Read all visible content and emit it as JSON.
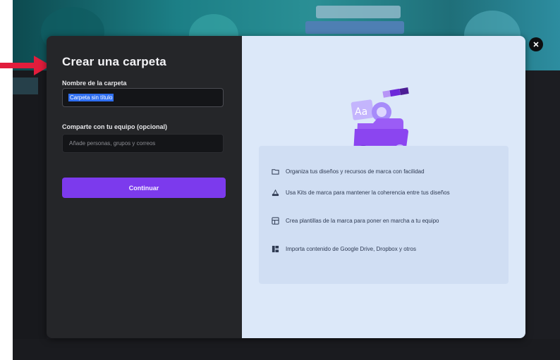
{
  "dialog": {
    "title": "Crear una carpeta",
    "name_label": "Nombre de la carpeta",
    "name_value": "Carpeta sin título",
    "share_label": "Comparte con tu equipo (opcional)",
    "share_placeholder": "Añade personas, grupos y correos",
    "continue_label": "Continuar"
  },
  "features": [
    {
      "icon": "folder-icon",
      "text": "Organiza tus diseños y recursos de marca con facilidad"
    },
    {
      "icon": "brand-kit-icon",
      "text": "Usa Kits de marca para mantener la coherencia entre tus diseños"
    },
    {
      "icon": "template-icon",
      "text": "Crea plantillas de la marca para poner en marcha a tu equipo"
    },
    {
      "icon": "import-icon",
      "text": "Importa contenido de Google Drive, Dropbox y otros"
    }
  ],
  "colors": {
    "accent": "#7c3aed",
    "dialog_left_bg": "#252629",
    "dialog_right_bg": "#dce8f9",
    "arrow": "#e11d3c"
  }
}
